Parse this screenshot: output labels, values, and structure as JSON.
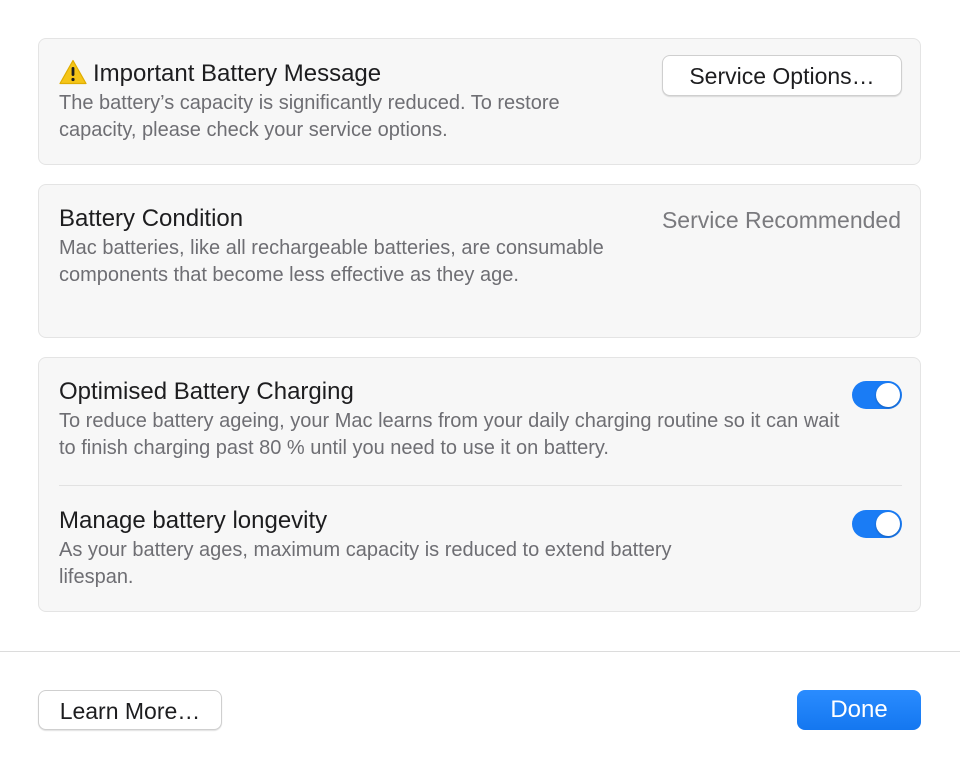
{
  "important": {
    "title": "Important Battery Message",
    "description": "The battery’s capacity is significantly reduced. To restore capacity, please check your service options.",
    "button_label": "Service Options…",
    "icon": "warning-triangle-icon"
  },
  "condition": {
    "title": "Battery Condition",
    "description": "Mac batteries, like all rechargeable batteries, are consumable components that become less effective as they age.",
    "status": "Service Recommended"
  },
  "settings": [
    {
      "title": "Optimised Battery Charging",
      "description": "To reduce battery ageing, your Mac learns from your daily charging routine so it can wait to finish charging past 80 % until you need to use it on battery.",
      "enabled": true
    },
    {
      "title": "Manage battery longevity",
      "description": "As your battery ages, maximum capacity is reduced to extend battery lifespan.",
      "enabled": true
    }
  ],
  "footer": {
    "learn_more_label": "Learn More…",
    "done_label": "Done"
  },
  "colors": {
    "accent": "#1a7cf5",
    "warning": "#f5c518"
  }
}
